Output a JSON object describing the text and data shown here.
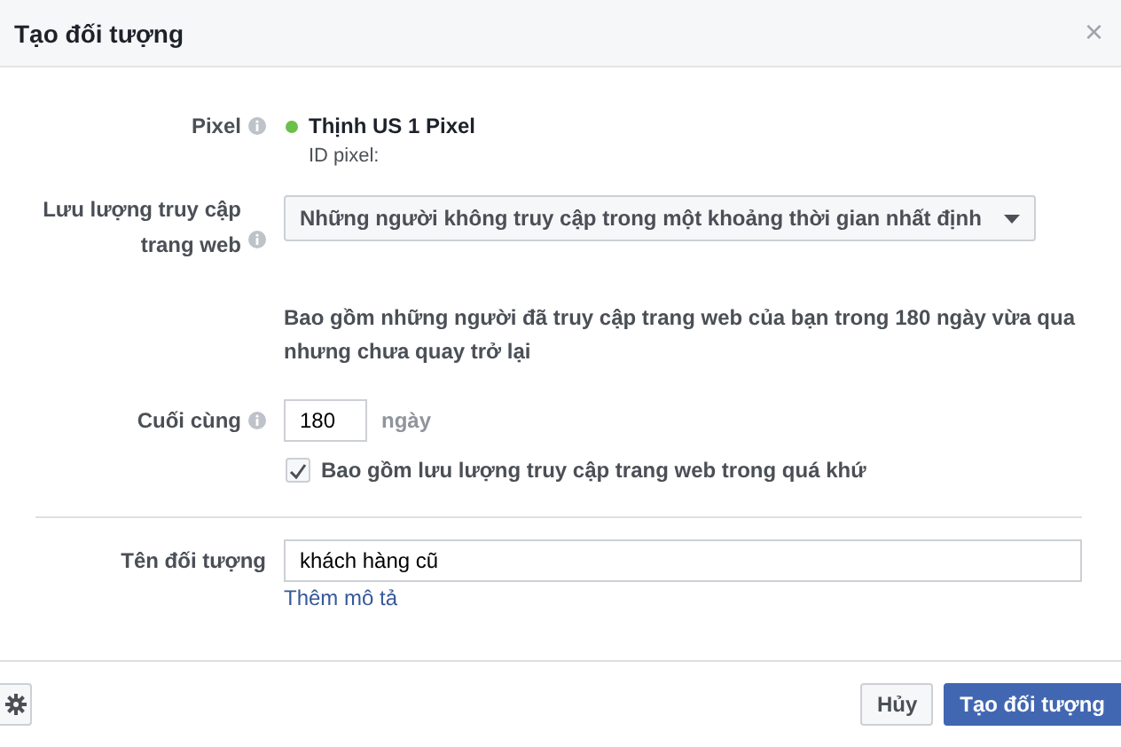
{
  "window": {
    "title": "Tạo đối tượng",
    "close": "×"
  },
  "pixel": {
    "label": "Pixel",
    "color": "#6bc04b",
    "name": "Thịnh US 1 Pixel",
    "id_label": "ID pixel:"
  },
  "traffic": {
    "label": "Lưu lượng truy cập trang web",
    "value": "Những người không truy cập trong một khoảng thời gian nhất định",
    "description": "Bao gồm những người đã truy cập trang web của bạn trong 180 ngày vừa qua nhưng chưa quay trở lại"
  },
  "last": {
    "label": "Cuối cùng",
    "value": "180",
    "unit": "ngày"
  },
  "include_past": {
    "label": "Bao gồm lưu lượng truy cập trang web trong quá khứ",
    "checked": true
  },
  "audience_name": {
    "label": "Tên đối tượng",
    "value": "khách hàng cũ",
    "link": "Thêm mô tả"
  },
  "buttons": [
    {
      "label": "Hủy",
      "kind": "secondary"
    },
    {
      "label": "Tạo đối tượng",
      "kind": "primary"
    }
  ]
}
